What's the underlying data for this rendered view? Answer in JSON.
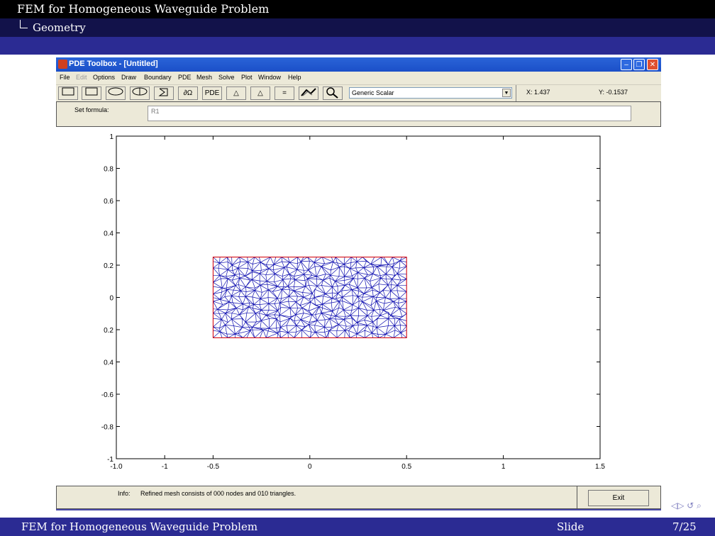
{
  "slide": {
    "header_title": "FEM for Homogeneous Waveguide Problem",
    "header_subtitle": "Geometry",
    "footer_left": "FEM for Homogeneous Waveguide Problem",
    "footer_mid": "Slide",
    "footer_right": "7/25",
    "nav_symbols": "◁▷ ↺ ⌕"
  },
  "window": {
    "title": "PDE Toolbox - [Untitled]",
    "menu": [
      "File",
      "Edit",
      "Options",
      "Draw",
      "Boundary",
      "PDE",
      "Mesh",
      "Solve",
      "Plot",
      "Window",
      "Help"
    ],
    "toolbar_icons": [
      "rectangle-corner-icon",
      "rectangle-center-icon",
      "ellipse-corner-icon",
      "ellipse-center-icon",
      "polygon-icon",
      "boundary-mode-icon",
      "pde-mode-icon",
      "init-mesh-icon",
      "refine-mesh-icon",
      "solve-icon",
      "plot-icon",
      "zoom-icon"
    ],
    "toolbar_labels": [
      "",
      "",
      "",
      "",
      "",
      "∂Ω",
      "PDE",
      "△",
      "△",
      "=",
      "",
      ""
    ],
    "mode_select": "Generic Scalar",
    "x_coord": "X: 1.437",
    "y_coord": "Y: -0.1537",
    "set_formula_label": "Set formula:",
    "set_formula_value": "R1",
    "info_label": "Info:",
    "info_text": "Refined mesh consists of 000 nodes and 010 triangles.",
    "exit_label": "Exit"
  },
  "chart_data": {
    "type": "mesh-plot",
    "xlim": [
      -1.0,
      1.5
    ],
    "ylim": [
      -1.0,
      1.0
    ],
    "x_ticks": [
      "-1.0",
      "-1",
      "-0.5",
      "0",
      "0.5",
      "1",
      "1.5"
    ],
    "x_tick_values": [
      -1.0,
      -0.5,
      -0.5,
      0.0,
      0.5,
      1.0,
      1.5
    ],
    "x_tick_positions": [
      -1.0,
      -0.75,
      -0.5,
      0.0,
      0.5,
      1.0,
      1.5
    ],
    "y_ticks": [
      "1",
      "0.8",
      "0.6",
      "0.4",
      "0.2",
      "0",
      "0.2",
      "0.4",
      "-0.6",
      "-0.8",
      "-1"
    ],
    "y_tick_values": [
      1,
      0.8,
      0.6,
      0.4,
      0.2,
      0,
      -0.2,
      -0.4,
      -0.6,
      -0.8,
      -1
    ],
    "rectangle": {
      "x0": -0.5,
      "x1": 0.5,
      "y0": -0.25,
      "y1": 0.25,
      "edge_color": "#e00000"
    },
    "mesh_color": "#1010b0",
    "grid": false
  }
}
